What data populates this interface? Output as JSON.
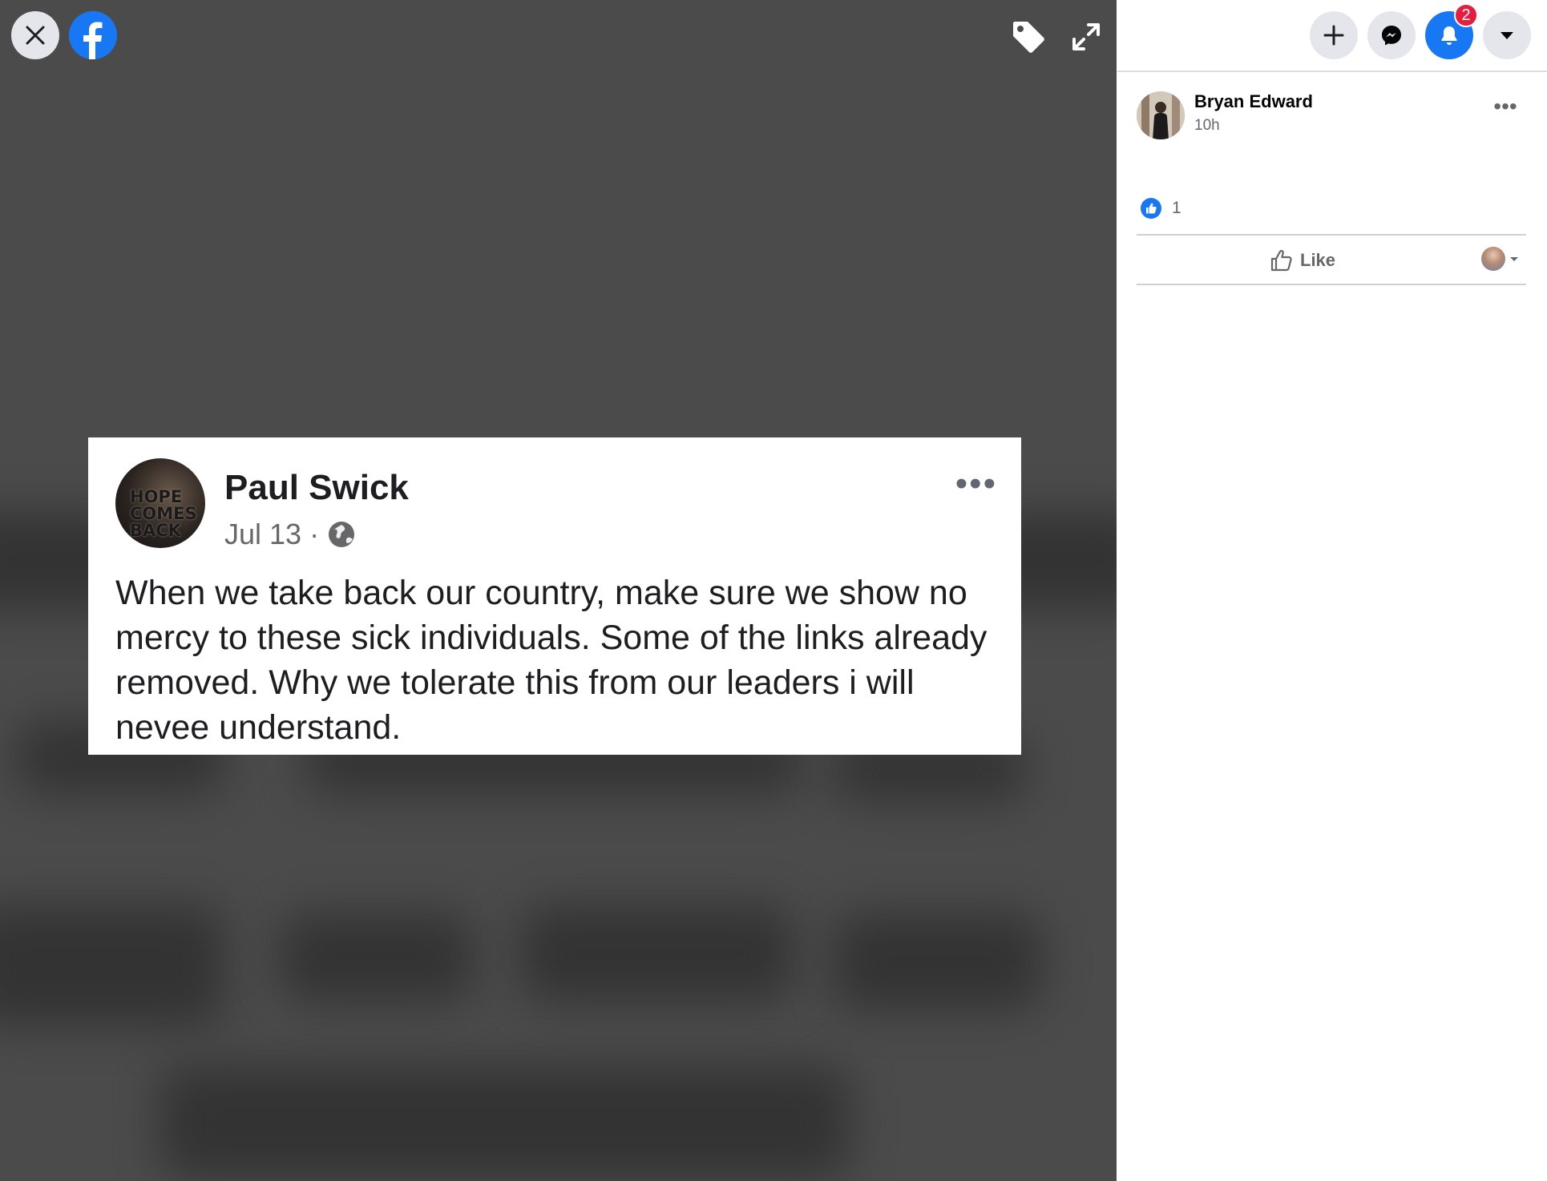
{
  "viewer": {
    "post": {
      "author": "Paul Swick",
      "avatar_text": "HOPE COMES BACK",
      "date": "Jul 13",
      "separator": "·",
      "more_label": "•••",
      "text": "When we take back our country, make sure we show no mercy to these sick individuals. Some of the links already removed. Why we tolerate this from our leaders i will nevee understand."
    },
    "icons": {
      "close": "close-icon",
      "logo": "facebook-logo-icon",
      "tag": "tag-icon",
      "expand": "expand-icon"
    }
  },
  "sidebar": {
    "header": {
      "buttons": [
        "plus-icon",
        "messenger-icon",
        "notifications-icon",
        "account-menu-icon"
      ],
      "notification_count": "2"
    },
    "author": {
      "name": "Bryan Edward",
      "time": "10h",
      "more_label": "•••"
    },
    "reactions": {
      "count": "1",
      "type": "like-reaction-icon"
    },
    "actions": {
      "like_label": "Like"
    }
  },
  "colors": {
    "brand": "#1877f2",
    "viewer_bg": "#4b4b4b",
    "badge": "#e41e3f",
    "secondary_text": "#65676b"
  }
}
